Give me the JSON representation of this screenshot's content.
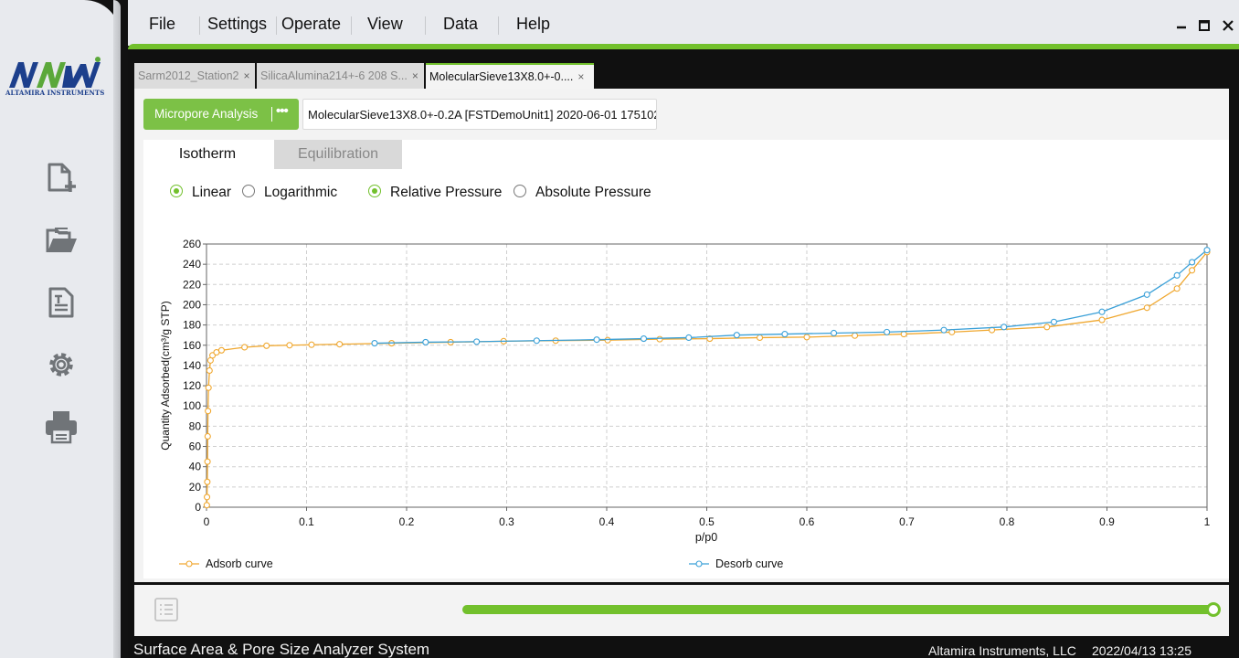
{
  "window": {
    "minimize_icon": "minimize-icon",
    "maximize_icon": "maximize-icon",
    "close_icon": "close-icon"
  },
  "brand": {
    "logo_text": "ALTAMIRA INSTRUMENTS",
    "colors": {
      "accent": "#72c02c",
      "logo_blue": "#1c3f8c",
      "logo_green": "#5ba83a"
    }
  },
  "menu": {
    "items": [
      "File",
      "Settings",
      "Operate",
      "View",
      "Data",
      "Help"
    ]
  },
  "sidebar": {
    "items": [
      {
        "name": "new-file-icon"
      },
      {
        "name": "open-folder-icon"
      },
      {
        "name": "report-icon"
      },
      {
        "name": "settings-gear-icon"
      },
      {
        "name": "printer-icon"
      }
    ]
  },
  "tabs": [
    {
      "label": "Sarm2012_Station2",
      "active": false
    },
    {
      "label": "SilicaAlumina214+-6 208 S...",
      "active": false
    },
    {
      "label": "MolecularSieve13X8.0+-0....",
      "active": true
    }
  ],
  "toolbar": {
    "mode_label": "Micropore Analysis",
    "more_label": "•••",
    "sample_label": "MolecularSieve13X8.0+-0.2A [FSTDemoUnit1] 2020-06-01 175102"
  },
  "subtabs": {
    "isotherm": "Isotherm",
    "equilibration": "Equilibration"
  },
  "options": {
    "linear": "Linear",
    "logarithmic": "Logarithmic",
    "relative": "Relative Pressure",
    "absolute": "Absolute Pressure",
    "scale_selected": "linear",
    "pressure_selected": "relative"
  },
  "chart_data": {
    "type": "line",
    "xlabel": "p/p0",
    "ylabel": "Quantity Adsorbed(cm³/g STP)",
    "xlim": [
      0,
      1
    ],
    "ylim": [
      0,
      260
    ],
    "xticks": [
      0,
      0.1,
      0.2,
      0.3,
      0.4,
      0.5,
      0.6,
      0.7,
      0.8,
      0.9,
      1
    ],
    "yticks": [
      0,
      20,
      40,
      60,
      80,
      100,
      120,
      140,
      160,
      180,
      200,
      220,
      240,
      260
    ],
    "grid": true,
    "legend_position": "bottom",
    "series": [
      {
        "name": "Adsorb curve",
        "color": "#f0a830",
        "x": [
          0.0003,
          0.0005,
          0.0008,
          0.001,
          0.0012,
          0.0015,
          0.002,
          0.003,
          0.004,
          0.006,
          0.01,
          0.015,
          0.038,
          0.06,
          0.083,
          0.105,
          0.133,
          0.185,
          0.244,
          0.297,
          0.349,
          0.401,
          0.453,
          0.503,
          0.553,
          0.6,
          0.648,
          0.697,
          0.745,
          0.785,
          0.84,
          0.895,
          0.94,
          0.97,
          0.985,
          1.0
        ],
        "y": [
          2,
          10,
          25,
          45,
          70,
          95,
          118,
          135,
          145,
          150,
          153,
          155,
          158,
          159.5,
          160,
          160.5,
          161,
          162,
          163,
          164,
          164.5,
          165,
          166,
          166.5,
          167.5,
          168,
          169.5,
          171,
          173,
          175,
          178,
          185,
          197,
          216,
          234,
          252
        ]
      },
      {
        "name": "Desorb curve",
        "color": "#3aa0d8",
        "x": [
          1.0,
          0.985,
          0.97,
          0.94,
          0.895,
          0.847,
          0.797,
          0.737,
          0.68,
          0.627,
          0.578,
          0.53,
          0.482,
          0.437,
          0.39,
          0.33,
          0.27,
          0.219,
          0.168
        ],
        "y": [
          254,
          242,
          229,
          210,
          193,
          183,
          178,
          175,
          173,
          172,
          171,
          170,
          167.5,
          166.5,
          165.5,
          164.5,
          163.5,
          163,
          162
        ]
      }
    ]
  },
  "progress": {
    "fraction": 1.0
  },
  "status": {
    "title": "Surface Area & Pore Size Analyzer System",
    "company": "Altamira Instruments, LLC",
    "datetime": "2022/04/13 13:25"
  }
}
